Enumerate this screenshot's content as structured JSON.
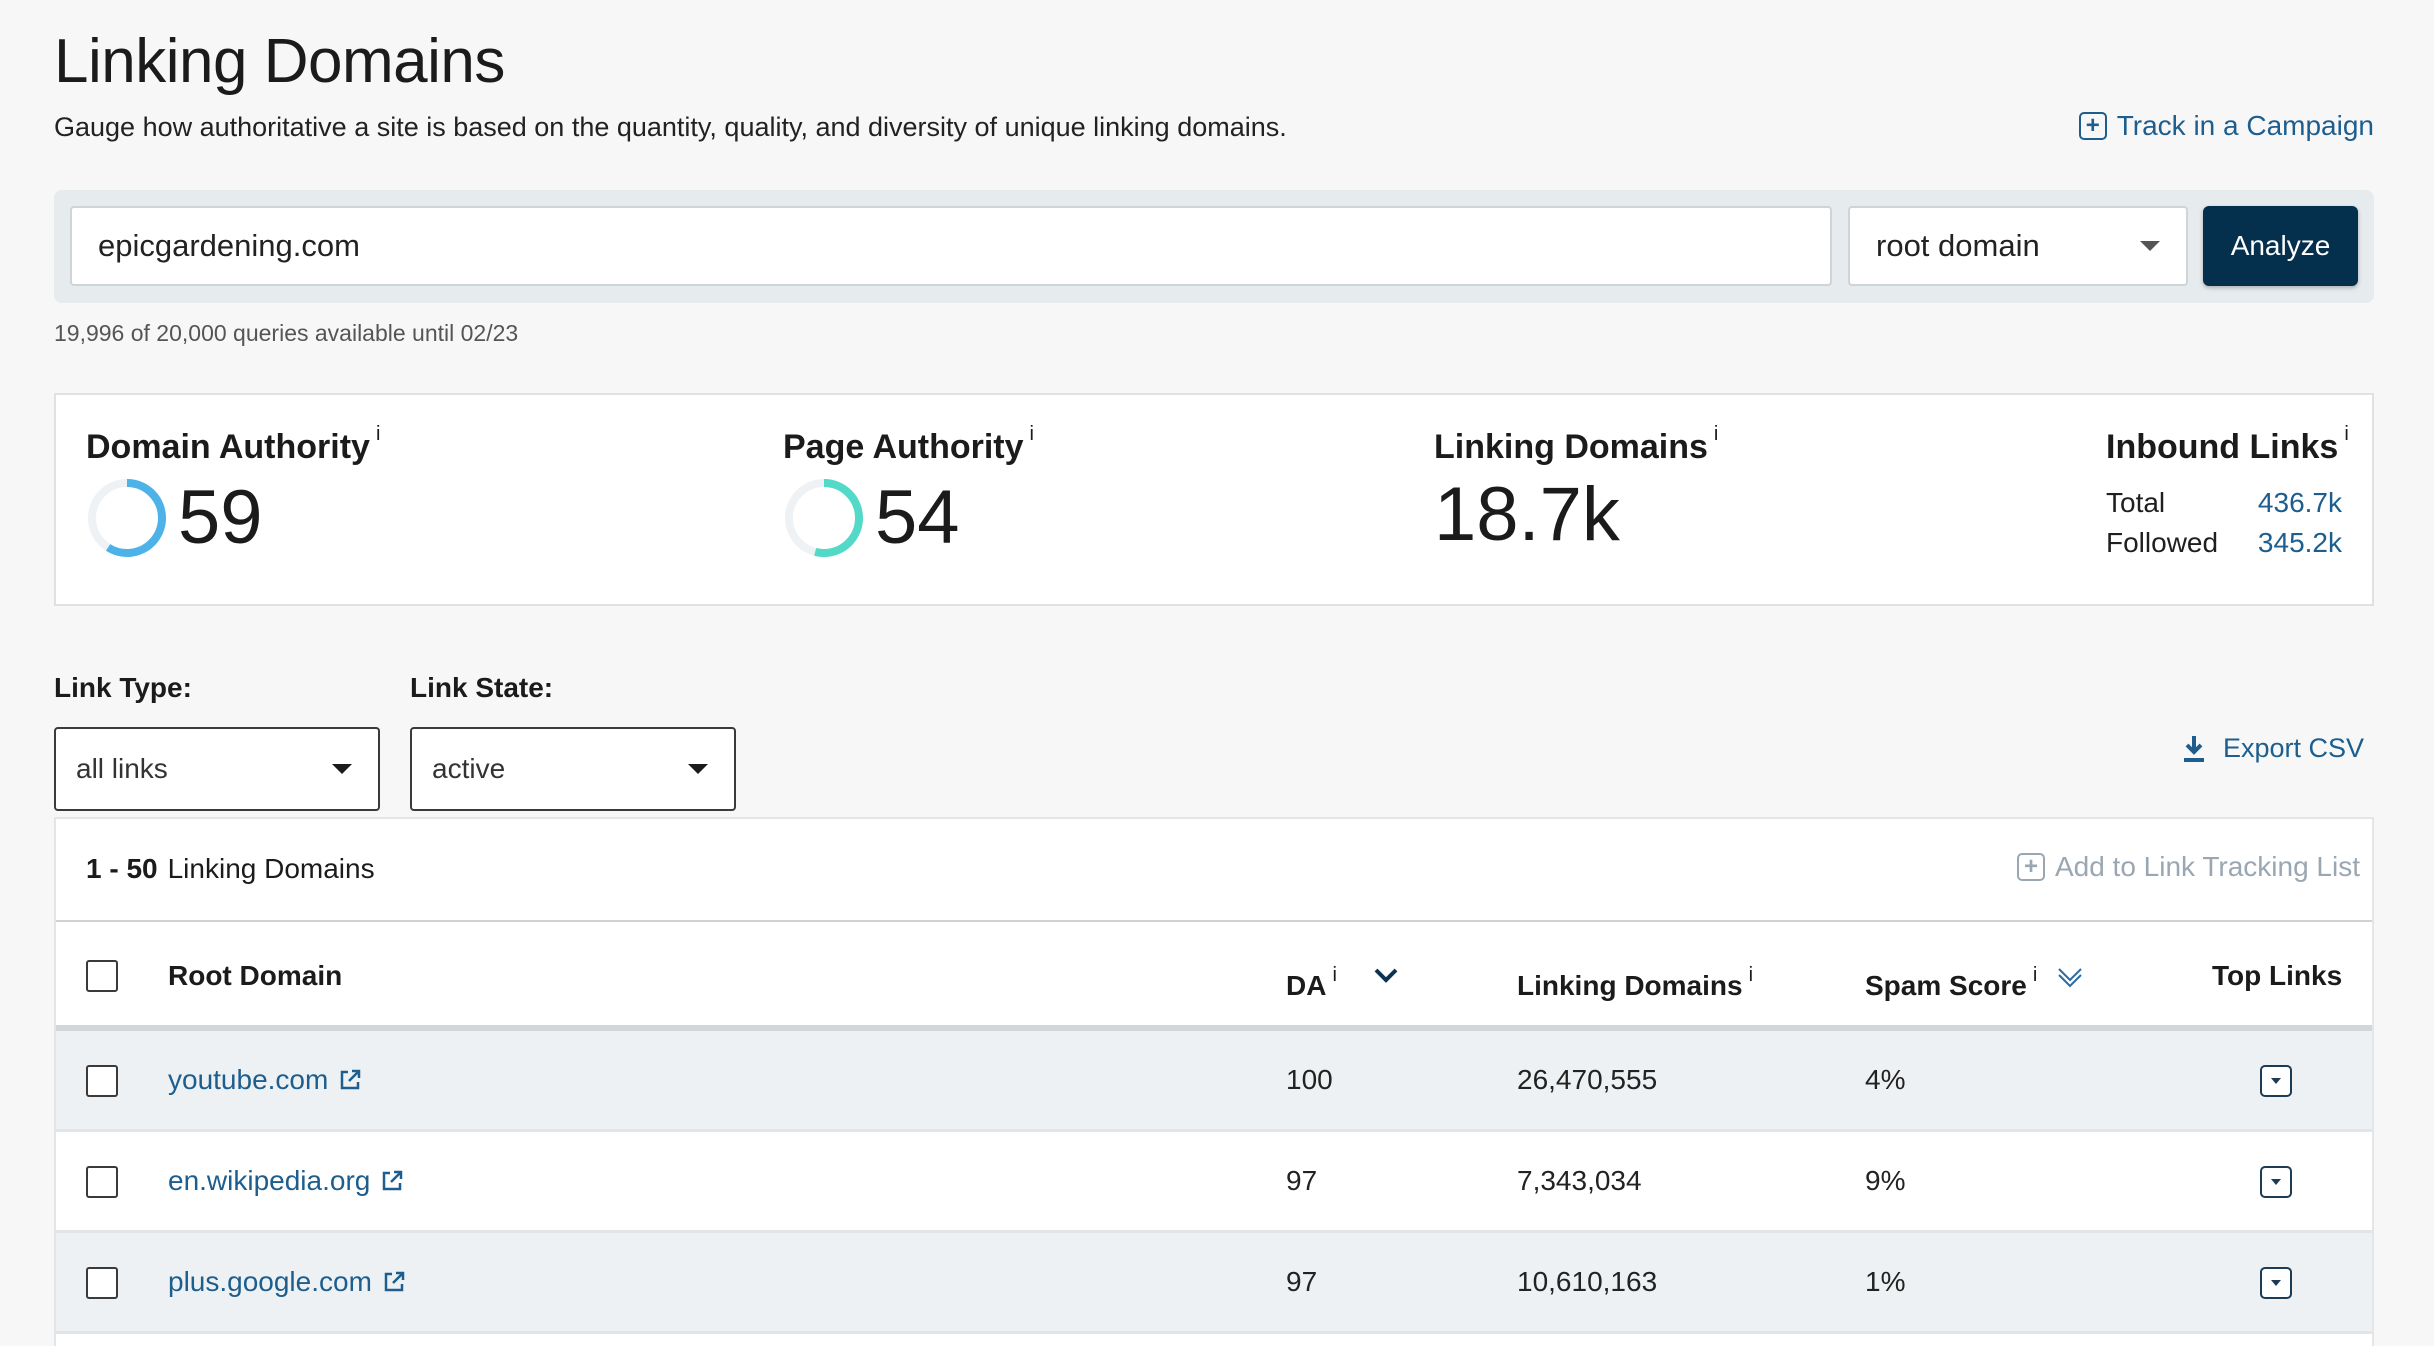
{
  "header": {
    "title": "Linking Domains",
    "subtitle": "Gauge how authoritative a site is based on the quantity, quality, and diversity of unique linking domains.",
    "track_link": "Track in a Campaign"
  },
  "search": {
    "value": "epicgardening.com",
    "scope": "root domain",
    "analyze_label": "Analyze",
    "quota": "19,996 of 20,000 queries available until 02/23"
  },
  "metrics": {
    "domain_authority": {
      "label": "Domain Authority",
      "info": "i",
      "value": "59",
      "fraction": 0.59,
      "color": "#4db2e8"
    },
    "page_authority": {
      "label": "Page Authority",
      "info": "i",
      "value": "54",
      "fraction": 0.54,
      "color": "#52d9c8"
    },
    "linking_domains": {
      "label": "Linking Domains",
      "info": "i",
      "value": "18.7k"
    },
    "inbound_links": {
      "label": "Inbound Links",
      "info": "i",
      "total_label": "Total",
      "total_value": "436.7k",
      "followed_label": "Followed",
      "followed_value": "345.2k"
    }
  },
  "filters": {
    "link_type_label": "Link Type:",
    "link_type_value": "all links",
    "link_state_label": "Link State:",
    "link_state_value": "active",
    "export_label": "Export CSV"
  },
  "results": {
    "range": "1 - 50",
    "range_label": "Linking Domains",
    "add_tracking": "Add to Link Tracking List",
    "columns": {
      "root_domain": "Root Domain",
      "da": "DA",
      "linking_domains": "Linking Domains",
      "spam_score": "Spam Score",
      "top_links": "Top Links",
      "info": "i"
    },
    "rows": [
      {
        "domain": "youtube.com",
        "da": "100",
        "linking_domains": "26,470,555",
        "spam": "4%"
      },
      {
        "domain": "en.wikipedia.org",
        "da": "97",
        "linking_domains": "7,343,034",
        "spam": "9%"
      },
      {
        "domain": "plus.google.com",
        "da": "97",
        "linking_domains": "10,610,163",
        "spam": "1%"
      }
    ]
  },
  "colors": {
    "primary_button": "#042f4d",
    "link": "#1d5e8e",
    "disabled": "#9aa7b2"
  }
}
